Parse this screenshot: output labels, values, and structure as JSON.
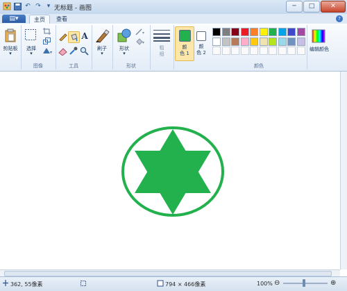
{
  "window": {
    "title": "无标题 - 画图",
    "minimize": "─",
    "maximize": "□",
    "close": "✕"
  },
  "tabs": {
    "app_menu": "▤▾",
    "home": "主页",
    "view": "查看",
    "help": "?"
  },
  "ribbon": {
    "clipboard": {
      "paste": "剪贴板",
      "group": ""
    },
    "image": {
      "select": "选择",
      "group": "图像"
    },
    "tools": {
      "group": "工具"
    },
    "brushes": {
      "label": "刷子"
    },
    "shapes": {
      "label": "形状",
      "group": "形状"
    },
    "size": {
      "label_top": "粗",
      "label_bottom": "细"
    },
    "color1": {
      "label_top": "颜",
      "label_bottom": "色 1",
      "color": "#22b14c"
    },
    "color2": {
      "label_top": "颜",
      "label_bottom": "色 2",
      "color": "#ffffff"
    },
    "colors_group": "颜色",
    "edit_colors": "编辑颜色",
    "palette_row1": [
      "#000000",
      "#7f7f7f",
      "#880015",
      "#ed1c24",
      "#ff7f27",
      "#fff200",
      "#22b14c",
      "#00a2e8",
      "#3f48cc",
      "#a349a4"
    ],
    "palette_row2": [
      "#ffffff",
      "#c3c3c3",
      "#b97a57",
      "#ffaec9",
      "#ffc90e",
      "#efe4b0",
      "#b5e61d",
      "#99d9ea",
      "#7092be",
      "#c8bfe7"
    ]
  },
  "drawing": {
    "stroke_color": "#22b14c",
    "fill_color": "#22b14c"
  },
  "status": {
    "cursor_pos": "362, 55像素",
    "canvas_size": "794 × 466像素",
    "zoom": "100%",
    "zoom_out": "⊖",
    "zoom_in": "⊕"
  }
}
